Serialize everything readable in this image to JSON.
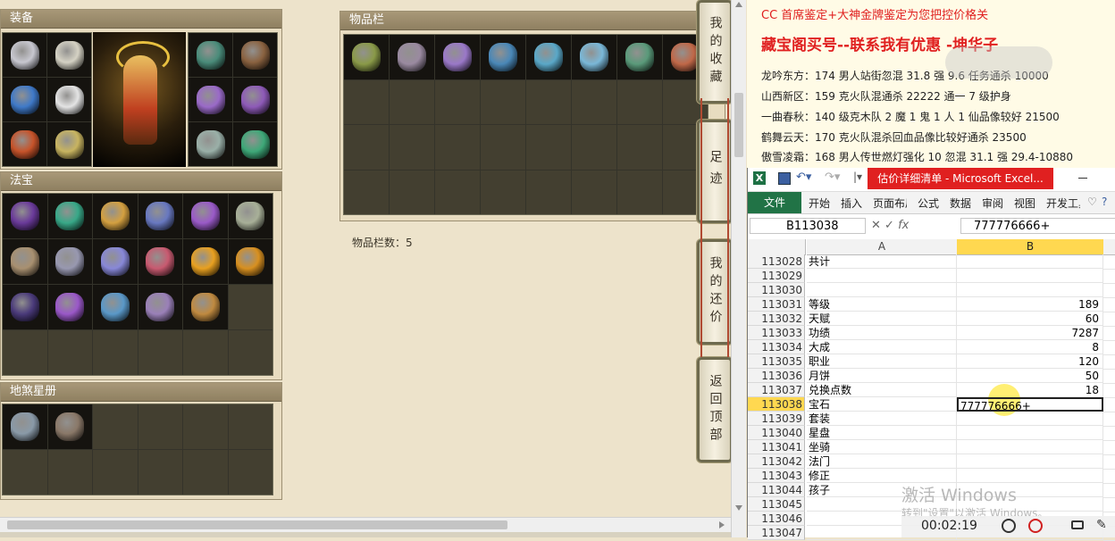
{
  "equip": {
    "title": "装备",
    "items": [
      {
        "c": "#c8c8d0"
      },
      {
        "c": "#d5d2c4"
      },
      {
        "c": "#4a8c7a"
      },
      {
        "c": "#8a6240"
      },
      {
        "c": "#3f79c8"
      },
      {
        "c": "#e4e4e4"
      },
      {
        "c": "#9a6ac8"
      },
      {
        "c": "#8e5ab8"
      },
      {
        "c": "#c6532a"
      },
      {
        "c": "#c8b460"
      },
      {
        "c": "#9ab0a8"
      },
      {
        "c": "#3ea878"
      }
    ]
  },
  "fabao": {
    "title": "法宝",
    "items": [
      {
        "c": "#6a3a9a"
      },
      {
        "c": "#38a888"
      },
      {
        "c": "#d4a040"
      },
      {
        "c": "#6878c0"
      },
      {
        "c": "#9a5ac8"
      },
      {
        "c": "#a8b098"
      },
      {
        "c": "#a89070"
      },
      {
        "c": "#9898b0"
      },
      {
        "c": "#8888d8"
      },
      {
        "c": "#c85a70"
      },
      {
        "c": "#e8a020"
      },
      {
        "c": "#d89020"
      },
      {
        "c": "#4a3a7a"
      },
      {
        "c": "#9a58c8"
      },
      {
        "c": "#5a98c8"
      },
      {
        "c": "#9a80b8"
      },
      {
        "c": "#c08a40"
      }
    ]
  },
  "dishaxing": {
    "title": "地煞星册",
    "items": [
      {
        "c": "#8a9aa8"
      },
      {
        "c": "#8a7868"
      }
    ]
  },
  "inventory": {
    "title": "物品栏",
    "count_label": "物品栏数：5",
    "items": [
      {
        "c": "#8a9a48"
      },
      {
        "c": "#9a8aa0"
      },
      {
        "c": "#9a78c8"
      },
      {
        "c": "#4a88b8"
      },
      {
        "c": "#5aa8c8"
      },
      {
        "c": "#7ab8d8"
      },
      {
        "c": "#5a9a7a"
      },
      {
        "c": "#c06848"
      }
    ]
  },
  "side_buttons": [
    {
      "label": "我的收藏"
    },
    {
      "label": "足迹"
    },
    {
      "label": "我的还价"
    },
    {
      "label": "返回顶部"
    }
  ],
  "notes": {
    "line1": "CC 首席鉴定+大神金牌鉴定为您把控价格关",
    "line2": "藏宝阁买号--联系我有优惠 -坤华子",
    "line3": "龙吟东方：174 男人站街忽混 31.8 强 9.6 任务通杀 10000",
    "line4": "山西新区：159 克火队混通杀 22222 通一 7 级护身",
    "line5": "一曲春秋：140 级克木队 2 魔 1 鬼 1 人 1 仙品像较好 21500",
    "line6": "鹤舞云天：170 克火队混杀回血品像比较好通杀 23500",
    "line7": "傲雪凌霜：168 男人传世燃灯强化 10 忽混 31.1 强 29.4-10880"
  },
  "excel": {
    "window_title": "估价详细清单 - Microsoft Excel...",
    "ribbon_tabs": [
      "文件",
      "开始",
      "插入",
      "页面布局",
      "公式",
      "数据",
      "审阅",
      "视图",
      "开发工具"
    ],
    "name_box": "B113038",
    "formula": "777776666+",
    "col_a": "A",
    "col_b": "B",
    "rows": [
      {
        "n": "113028",
        "a": "共计",
        "b": ""
      },
      {
        "n": "113029",
        "a": "",
        "b": ""
      },
      {
        "n": "113030",
        "a": "",
        "b": ""
      },
      {
        "n": "113031",
        "a": "等级",
        "b": "189"
      },
      {
        "n": "113032",
        "a": "天赋",
        "b": "60"
      },
      {
        "n": "113033",
        "a": "功绩",
        "b": "7287"
      },
      {
        "n": "113034",
        "a": "大成",
        "b": "8"
      },
      {
        "n": "113035",
        "a": "职业",
        "b": "120"
      },
      {
        "n": "113036",
        "a": "月饼",
        "b": "50"
      },
      {
        "n": "113037",
        "a": "兑换点数",
        "b": "18"
      },
      {
        "n": "113038",
        "a": "宝石",
        "b": "777776666+"
      },
      {
        "n": "113039",
        "a": "套装",
        "b": ""
      },
      {
        "n": "113040",
        "a": "星盘",
        "b": ""
      },
      {
        "n": "113041",
        "a": "坐骑",
        "b": ""
      },
      {
        "n": "113042",
        "a": "法门",
        "b": ""
      },
      {
        "n": "113043",
        "a": "修正",
        "b": ""
      },
      {
        "n": "113044",
        "a": "孩子",
        "b": ""
      },
      {
        "n": "113045",
        "a": "",
        "b": ""
      },
      {
        "n": "113046",
        "a": "",
        "b": ""
      },
      {
        "n": "113047",
        "a": "",
        "b": ""
      }
    ],
    "watermark1": "激活 Windows",
    "watermark2": "转到\"设置\"以激活 Windows。",
    "timer": "00:02:19"
  }
}
